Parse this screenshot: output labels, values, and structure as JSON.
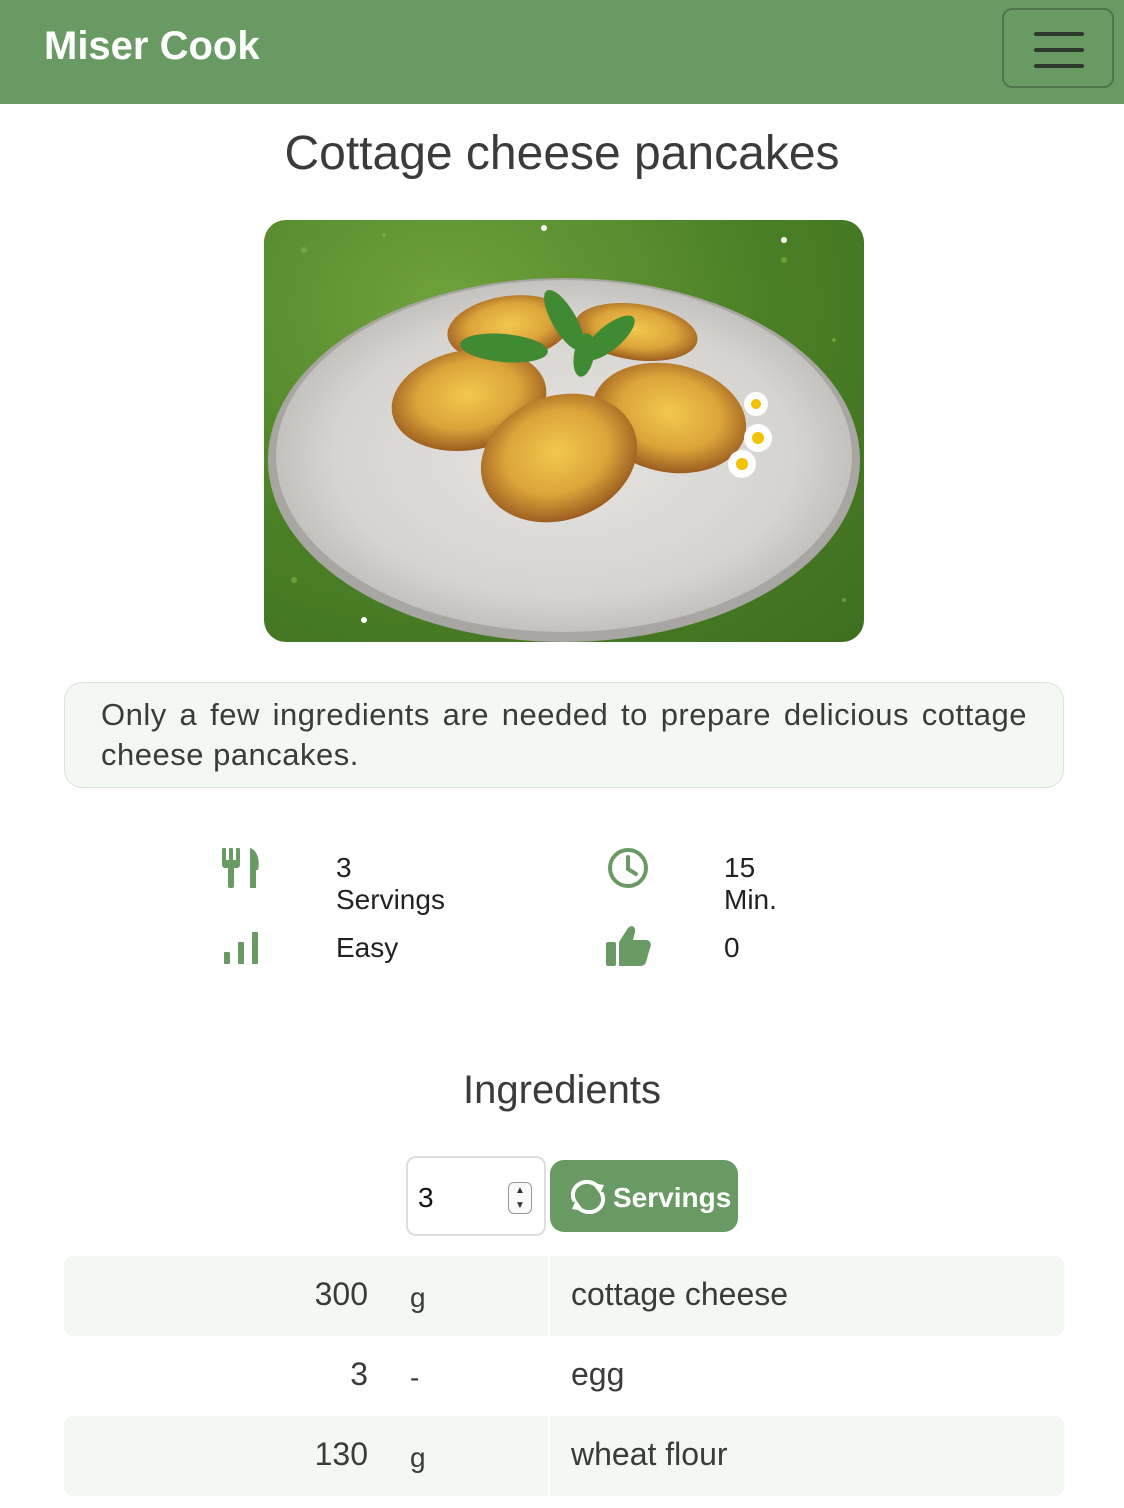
{
  "navbar": {
    "brand": "Miser Cook"
  },
  "recipe": {
    "title": "Cottage cheese pancakes",
    "description": "Only a few ingredients are needed to prepare delicious cottage cheese pancakes.",
    "image_alt": "cottage cheese pancakes on a plate",
    "facts": {
      "servings": "3 Servings",
      "time": "15 Min.",
      "difficulty": "Easy",
      "likes": "0"
    }
  },
  "ingredients": {
    "heading": "Ingredients",
    "servings_value": "3",
    "servings_button": "Servings",
    "rows": [
      {
        "amount": "300",
        "unit": "g",
        "name": "cottage cheese"
      },
      {
        "amount": "3",
        "unit": "-",
        "name": "egg"
      },
      {
        "amount": "130",
        "unit": "g",
        "name": "wheat flour"
      }
    ]
  },
  "icons": {
    "menu": "hamburger-icon",
    "servings": "fork-knife-icon",
    "time": "clock-icon",
    "difficulty": "bar-chart-icon",
    "likes": "thumbs-up-icon",
    "refresh": "refresh-icon"
  },
  "colors": {
    "primary": "#6a9a64",
    "light_bg": "#f4f8f3"
  }
}
